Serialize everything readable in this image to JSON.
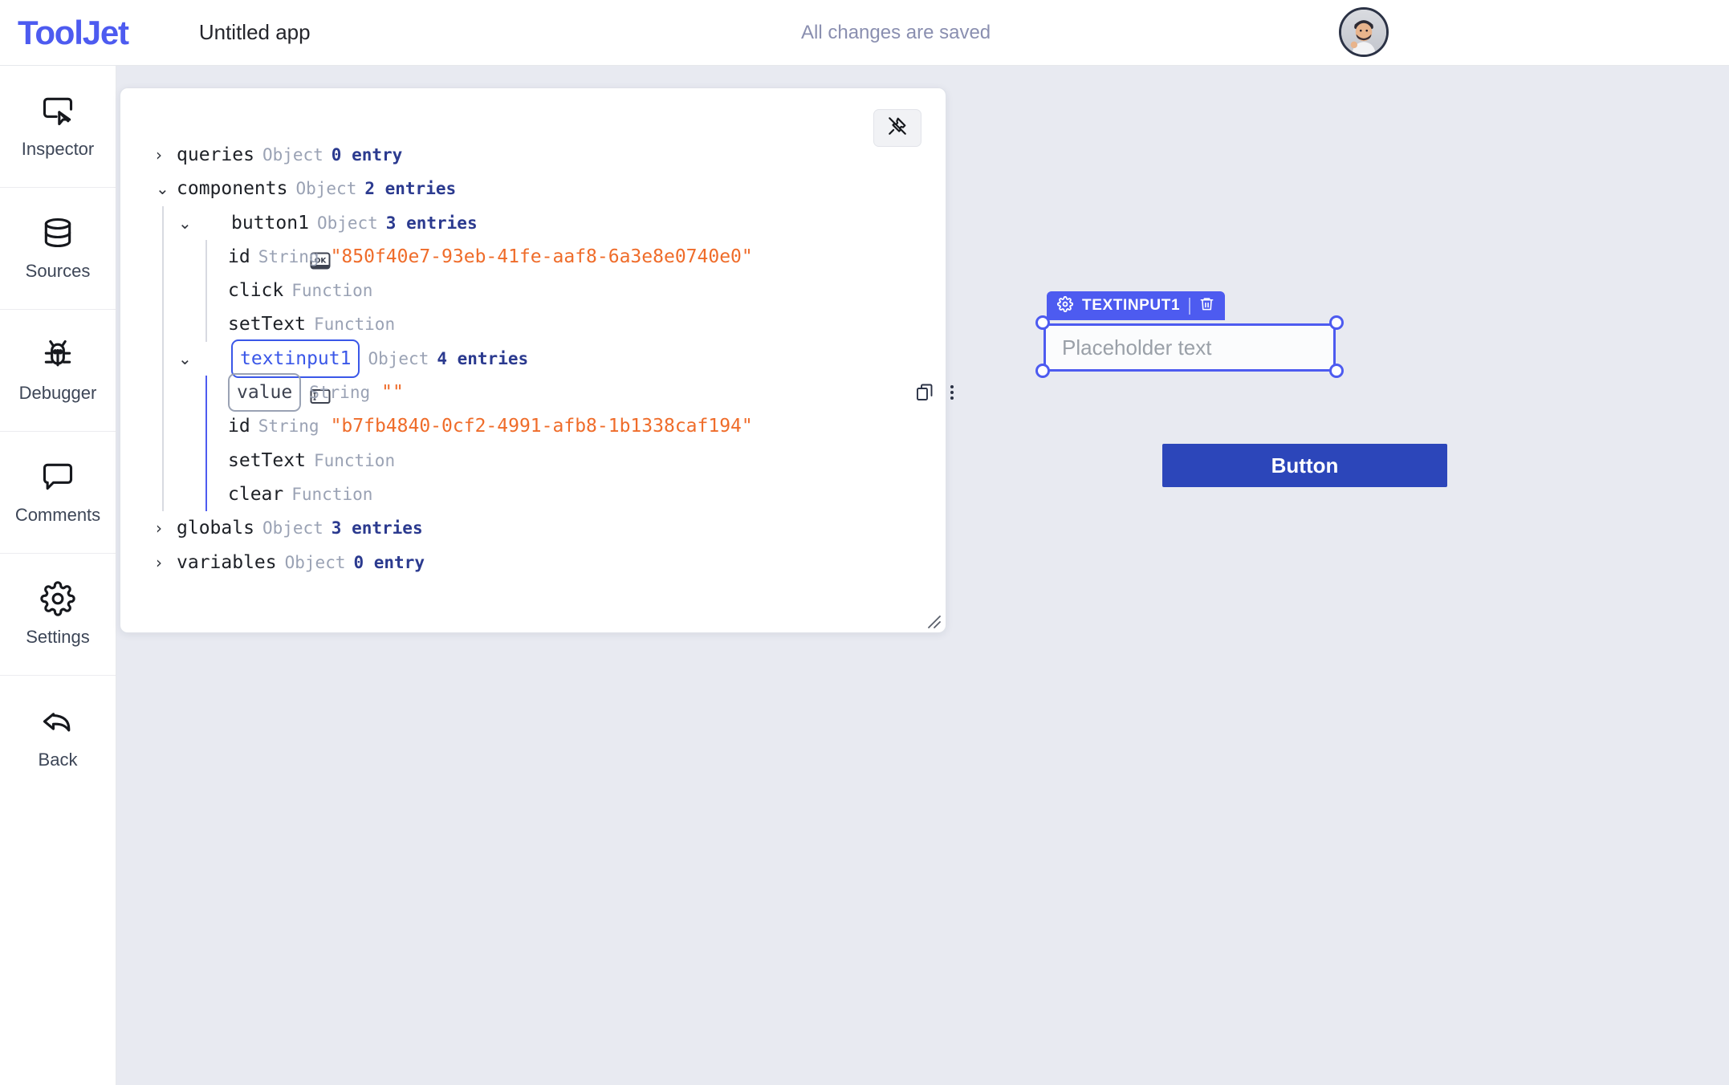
{
  "header": {
    "logo": "ToolJet",
    "app_title": "Untitled app",
    "save_status": "All changes are saved",
    "avatar_name": "user-avatar"
  },
  "sidebar": {
    "items": [
      {
        "label": "Inspector",
        "icon": "inspector-icon"
      },
      {
        "label": "Sources",
        "icon": "database-icon"
      },
      {
        "label": "Debugger",
        "icon": "bug-icon"
      },
      {
        "label": "Comments",
        "icon": "comment-icon"
      },
      {
        "label": "Settings",
        "icon": "gear-icon"
      },
      {
        "label": "Back",
        "icon": "back-arrow-icon"
      }
    ]
  },
  "inspector": {
    "pin_button": "pin-off-icon",
    "resize_handle": "resize-grip",
    "tree": [
      {
        "caret": "›",
        "key": "queries",
        "type": "Object",
        "count": "0 entry",
        "indent": 1
      },
      {
        "caret": "⌄",
        "key": "components",
        "type": "Object",
        "count": "2 entries",
        "indent": 1
      },
      {
        "caret": "⌄",
        "icon": "ok-key-icon",
        "key": "button1",
        "type": "Object",
        "count": "3 entries",
        "indent": 2
      },
      {
        "key": "id",
        "type": "String",
        "value": "\"850f40e7-93eb-41fe-aaf8-6a3e8e0740e0\"",
        "indent": 3
      },
      {
        "key": "click",
        "type": "Function",
        "indent": 3
      },
      {
        "key": "setText",
        "type": "Function",
        "indent": 3
      },
      {
        "caret": "⌄",
        "icon": "text-input-icon",
        "key": "textinput1",
        "key_chip": "blue",
        "type": "Object",
        "count": "4 entries",
        "indent": 2
      },
      {
        "key": "value",
        "key_chip": "gray",
        "type": "String",
        "value": "\"\"",
        "indent": 3,
        "actions": [
          "copy-icon",
          "more-vertical-icon"
        ]
      },
      {
        "key": "id",
        "type": "String",
        "value": "\"b7fb4840-0cf2-4991-afb8-1b1338caf194\"",
        "indent": 3
      },
      {
        "key": "setText",
        "type": "Function",
        "indent": 3
      },
      {
        "key": "clear",
        "type": "Function",
        "indent": 3
      },
      {
        "caret": "›",
        "key": "globals",
        "type": "Object",
        "count": "3 entries",
        "indent": 1
      },
      {
        "caret": "›",
        "key": "variables",
        "type": "Object",
        "count": "0 entry",
        "indent": 1
      }
    ]
  },
  "canvas": {
    "textinput_widget": {
      "label": "TEXTINPUT1",
      "settings_icon": "gear-icon",
      "delete_icon": "trash-icon",
      "placeholder": "Placeholder text",
      "value": ""
    },
    "button_widget": {
      "label": "Button"
    }
  },
  "colors": {
    "brand": "#4d5bf0",
    "button": "#2c46ba",
    "string": "#ef6c2a",
    "type": "#9aa2b4",
    "count": "#2b3a8f",
    "canvas_bg": "#e8eaf1"
  }
}
